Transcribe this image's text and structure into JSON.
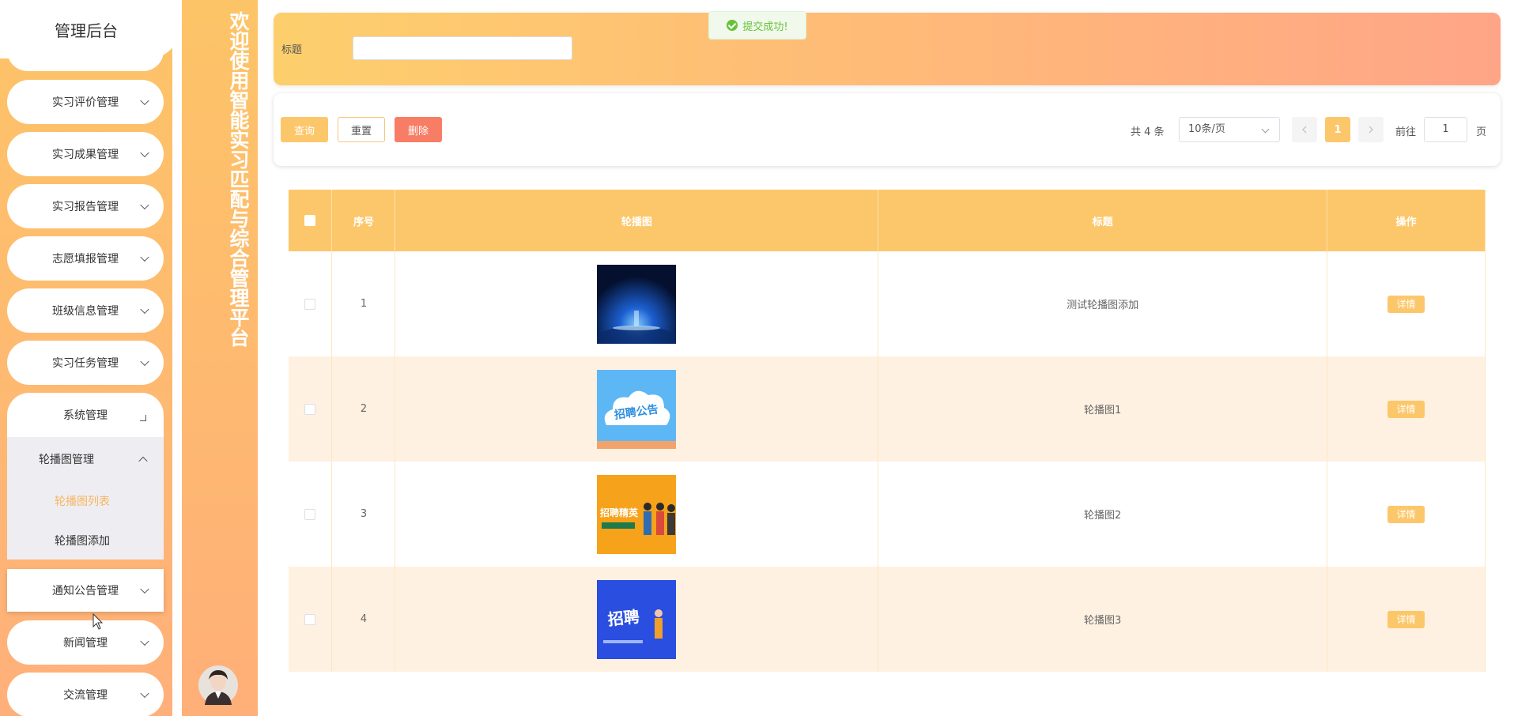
{
  "sidebar": {
    "app_title": "管理后台",
    "items": [
      {
        "label": "实习评价管理"
      },
      {
        "label": "实习成果管理"
      },
      {
        "label": "实习报告管理"
      },
      {
        "label": "志愿填报管理"
      },
      {
        "label": "班级信息管理"
      },
      {
        "label": "实习任务管理"
      }
    ],
    "system": {
      "label": "系统管理",
      "carousel": {
        "label": "轮播图管理",
        "children": [
          {
            "label": "轮播图列表",
            "active": true
          },
          {
            "label": "轮播图添加"
          }
        ]
      }
    },
    "after": [
      {
        "label": "通知公告管理"
      },
      {
        "label": "新闻管理"
      },
      {
        "label": "交流管理"
      }
    ]
  },
  "banner": {
    "text": "欢迎使用智能实习匹配与综合管理平台"
  },
  "search": {
    "title_label": "标题",
    "title_value": ""
  },
  "toast": {
    "message": "提交成功!"
  },
  "actions": {
    "query": "查询",
    "reset": "重置",
    "delete": "删除"
  },
  "pagination": {
    "total": "共 4 条",
    "page_size": "10条/页",
    "current_page": "1",
    "goto_label": "前往",
    "goto_value": "1",
    "page_suffix": "页"
  },
  "table": {
    "headers": {
      "index": "序号",
      "image": "轮播图",
      "title": "标题",
      "action": "操作"
    },
    "rows": [
      {
        "index": "1",
        "title": "测试轮播图添加",
        "action": "详情",
        "image": "tech-light-image"
      },
      {
        "index": "2",
        "title": "轮播图1",
        "action": "详情",
        "image": "notice-cloud-image",
        "image_text": "招聘公告"
      },
      {
        "index": "3",
        "title": "轮播图2",
        "action": "详情",
        "image": "recruit-people-image",
        "image_text": "招聘精英"
      },
      {
        "index": "4",
        "title": "轮播图3",
        "action": "详情",
        "image": "recruit-blue-image",
        "image_text": "招聘"
      }
    ]
  },
  "colors": {
    "accent": "#fcc76a",
    "danger": "#f87d65",
    "row_alt": "#fff1e1",
    "success": "#67c23a"
  }
}
